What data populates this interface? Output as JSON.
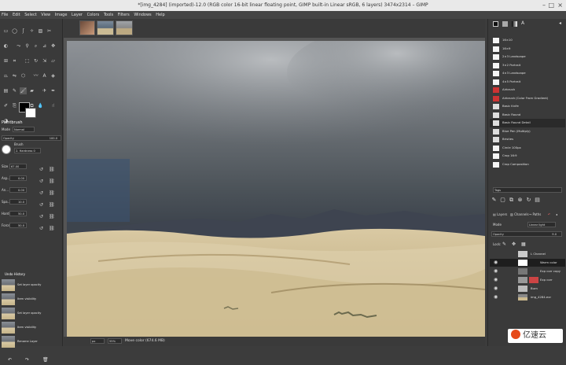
{
  "window": {
    "title": "*[img_4284] (imported)-12.0 (RGB color 16-bit linear floating point, GIMP built-in Linear sRGB, 6 layers) 3474x2314 – GIMP",
    "minimize": "–",
    "maximize": "□",
    "close": "×"
  },
  "menus": [
    "File",
    "Edit",
    "Select",
    "View",
    "Image",
    "Layer",
    "Colors",
    "Tools",
    "Filters",
    "Windows",
    "Help"
  ],
  "toolbox": {
    "title": "Paintbrush",
    "mode_label": "Mode",
    "mode_value": "Normal",
    "opacity_label": "Opacity",
    "opacity_value": "100.0",
    "brush_label": "Brush",
    "brush_value": "2. Hardness 0",
    "size_label": "Size",
    "size_value": "67.00",
    "aspect_label": "Asp...",
    "aspect_value": "0.00",
    "angle_label": "An...",
    "angle_value": "0.00",
    "spacing_label": "Spa...",
    "spacing_value": "10.0",
    "hardness_label": "Hardn...",
    "hardness_value": "50.0",
    "force_label": "Force",
    "force_value": "50.0"
  },
  "history": {
    "title": "Undo History",
    "items": [
      "Set layer opacity",
      "Item visibility",
      "Set layer opacity",
      "Item visibility",
      "Rename Layer"
    ]
  },
  "status": {
    "unit": "px",
    "zoom": "55%",
    "message": "Move color (674.6 MB)"
  },
  "brushes": {
    "items": [
      "16×10",
      "16×9",
      "2×3 Landscape",
      "3×2 Portrait",
      "4×3 Landscape",
      "4×5 Portrait",
      "Airbrush",
      "Airbrush (Color From Gradient)",
      "Basic Knife",
      "Basic Round",
      "Basic Round Detail",
      "Blue Pen (Multiply)",
      "Bristles",
      "Circle 100px",
      "Crop 16:9",
      "Crop Composition"
    ],
    "selected": 10,
    "tags_label": "Tags"
  },
  "layers": {
    "tabs": [
      "Layers",
      "Channels",
      "Paths"
    ],
    "mode_label": "Mode",
    "mode_value": "Linear light",
    "opacity_label": "Opacity",
    "opacity_value": "9.0",
    "lock_label": "Lock:",
    "items": [
      "L Channel",
      "Warm color",
      "Exp corr copy",
      "Exp corr",
      "Burn",
      "img_4284.exr"
    ]
  },
  "watermark": {
    "text": "亿速云"
  }
}
